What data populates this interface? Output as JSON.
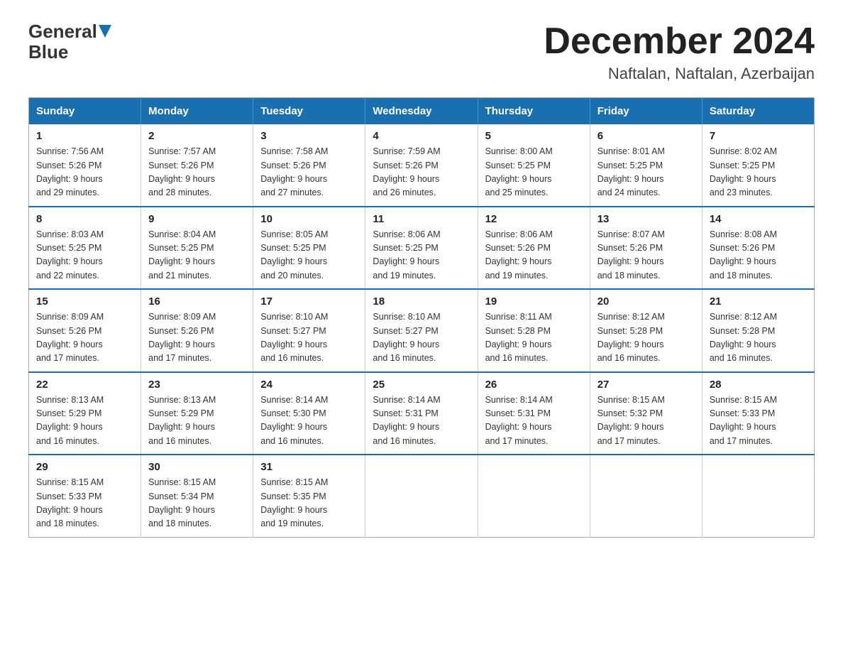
{
  "header": {
    "logo_general": "General",
    "logo_blue": "Blue",
    "month": "December 2024",
    "location": "Naftalan, Naftalan, Azerbaijan"
  },
  "weekdays": [
    "Sunday",
    "Monday",
    "Tuesday",
    "Wednesday",
    "Thursday",
    "Friday",
    "Saturday"
  ],
  "weeks": [
    [
      {
        "day": "1",
        "sunrise": "7:56 AM",
        "sunset": "5:26 PM",
        "daylight": "9 hours and 29 minutes."
      },
      {
        "day": "2",
        "sunrise": "7:57 AM",
        "sunset": "5:26 PM",
        "daylight": "9 hours and 28 minutes."
      },
      {
        "day": "3",
        "sunrise": "7:58 AM",
        "sunset": "5:26 PM",
        "daylight": "9 hours and 27 minutes."
      },
      {
        "day": "4",
        "sunrise": "7:59 AM",
        "sunset": "5:26 PM",
        "daylight": "9 hours and 26 minutes."
      },
      {
        "day": "5",
        "sunrise": "8:00 AM",
        "sunset": "5:25 PM",
        "daylight": "9 hours and 25 minutes."
      },
      {
        "day": "6",
        "sunrise": "8:01 AM",
        "sunset": "5:25 PM",
        "daylight": "9 hours and 24 minutes."
      },
      {
        "day": "7",
        "sunrise": "8:02 AM",
        "sunset": "5:25 PM",
        "daylight": "9 hours and 23 minutes."
      }
    ],
    [
      {
        "day": "8",
        "sunrise": "8:03 AM",
        "sunset": "5:25 PM",
        "daylight": "9 hours and 22 minutes."
      },
      {
        "day": "9",
        "sunrise": "8:04 AM",
        "sunset": "5:25 PM",
        "daylight": "9 hours and 21 minutes."
      },
      {
        "day": "10",
        "sunrise": "8:05 AM",
        "sunset": "5:25 PM",
        "daylight": "9 hours and 20 minutes."
      },
      {
        "day": "11",
        "sunrise": "8:06 AM",
        "sunset": "5:25 PM",
        "daylight": "9 hours and 19 minutes."
      },
      {
        "day": "12",
        "sunrise": "8:06 AM",
        "sunset": "5:26 PM",
        "daylight": "9 hours and 19 minutes."
      },
      {
        "day": "13",
        "sunrise": "8:07 AM",
        "sunset": "5:26 PM",
        "daylight": "9 hours and 18 minutes."
      },
      {
        "day": "14",
        "sunrise": "8:08 AM",
        "sunset": "5:26 PM",
        "daylight": "9 hours and 18 minutes."
      }
    ],
    [
      {
        "day": "15",
        "sunrise": "8:09 AM",
        "sunset": "5:26 PM",
        "daylight": "9 hours and 17 minutes."
      },
      {
        "day": "16",
        "sunrise": "8:09 AM",
        "sunset": "5:26 PM",
        "daylight": "9 hours and 17 minutes."
      },
      {
        "day": "17",
        "sunrise": "8:10 AM",
        "sunset": "5:27 PM",
        "daylight": "9 hours and 16 minutes."
      },
      {
        "day": "18",
        "sunrise": "8:10 AM",
        "sunset": "5:27 PM",
        "daylight": "9 hours and 16 minutes."
      },
      {
        "day": "19",
        "sunrise": "8:11 AM",
        "sunset": "5:28 PM",
        "daylight": "9 hours and 16 minutes."
      },
      {
        "day": "20",
        "sunrise": "8:12 AM",
        "sunset": "5:28 PM",
        "daylight": "9 hours and 16 minutes."
      },
      {
        "day": "21",
        "sunrise": "8:12 AM",
        "sunset": "5:28 PM",
        "daylight": "9 hours and 16 minutes."
      }
    ],
    [
      {
        "day": "22",
        "sunrise": "8:13 AM",
        "sunset": "5:29 PM",
        "daylight": "9 hours and 16 minutes."
      },
      {
        "day": "23",
        "sunrise": "8:13 AM",
        "sunset": "5:29 PM",
        "daylight": "9 hours and 16 minutes."
      },
      {
        "day": "24",
        "sunrise": "8:14 AM",
        "sunset": "5:30 PM",
        "daylight": "9 hours and 16 minutes."
      },
      {
        "day": "25",
        "sunrise": "8:14 AM",
        "sunset": "5:31 PM",
        "daylight": "9 hours and 16 minutes."
      },
      {
        "day": "26",
        "sunrise": "8:14 AM",
        "sunset": "5:31 PM",
        "daylight": "9 hours and 17 minutes."
      },
      {
        "day": "27",
        "sunrise": "8:15 AM",
        "sunset": "5:32 PM",
        "daylight": "9 hours and 17 minutes."
      },
      {
        "day": "28",
        "sunrise": "8:15 AM",
        "sunset": "5:33 PM",
        "daylight": "9 hours and 17 minutes."
      }
    ],
    [
      {
        "day": "29",
        "sunrise": "8:15 AM",
        "sunset": "5:33 PM",
        "daylight": "9 hours and 18 minutes."
      },
      {
        "day": "30",
        "sunrise": "8:15 AM",
        "sunset": "5:34 PM",
        "daylight": "9 hours and 18 minutes."
      },
      {
        "day": "31",
        "sunrise": "8:15 AM",
        "sunset": "5:35 PM",
        "daylight": "9 hours and 19 minutes."
      },
      null,
      null,
      null,
      null
    ]
  ],
  "labels": {
    "sunrise_prefix": "Sunrise: ",
    "sunset_prefix": "Sunset: ",
    "daylight_prefix": "Daylight: "
  }
}
